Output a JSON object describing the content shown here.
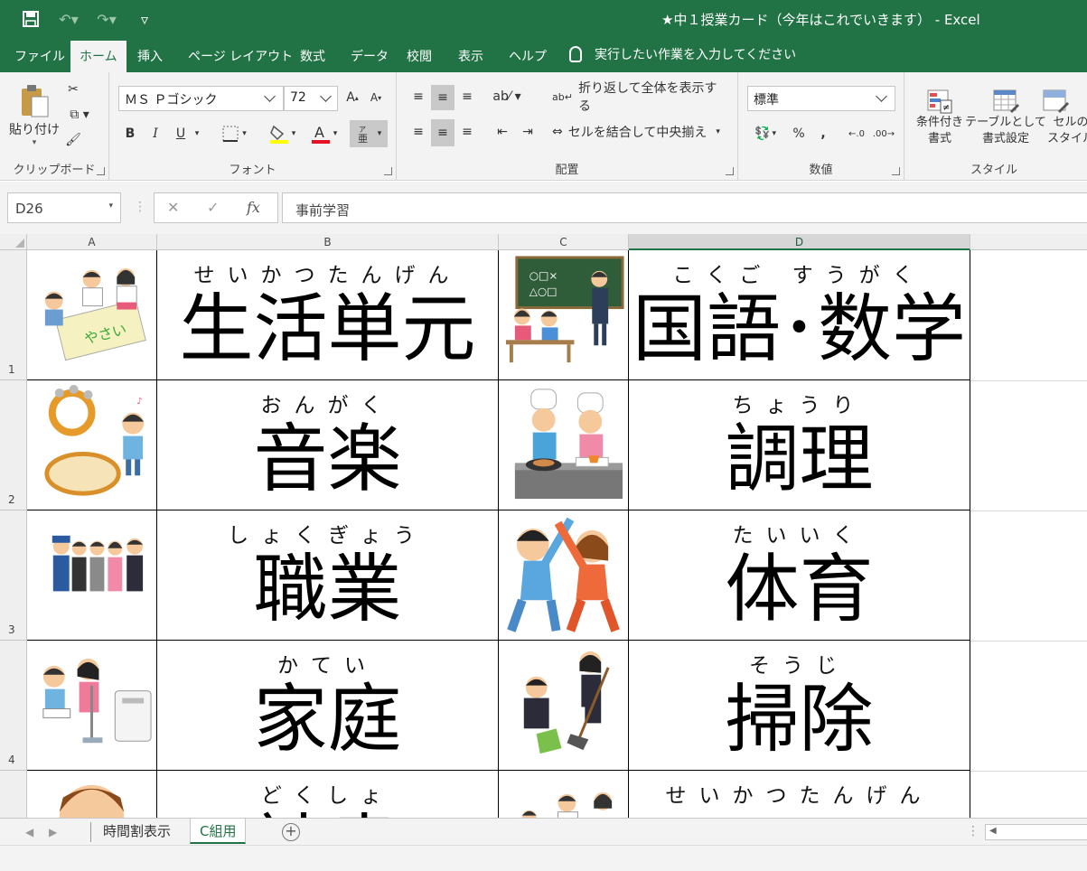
{
  "window": {
    "title": "★中１授業カード（今年はこれでいきます） - Excel"
  },
  "tabs": [
    {
      "label": "ファイル"
    },
    {
      "label": "ホーム"
    },
    {
      "label": "挿入"
    },
    {
      "label": "ページ レイアウト"
    },
    {
      "label": "数式"
    },
    {
      "label": "データ"
    },
    {
      "label": "校閲"
    },
    {
      "label": "表示"
    },
    {
      "label": "ヘルプ"
    }
  ],
  "tell_me": "実行したい作業を入力してください",
  "ribbon": {
    "clipboard": {
      "paste": "貼り付け",
      "label": "クリップボード"
    },
    "font": {
      "name": "ＭＳ Ｐゴシック",
      "size": "72",
      "label": "フォント",
      "bold": "B",
      "italic": "I",
      "underline": "U"
    },
    "alignment": {
      "wrap": "折り返して全体を表示する",
      "merge": "セルを結合して中央揃え",
      "label": "配置"
    },
    "number": {
      "format": "標準",
      "percent": "%",
      "comma": ",",
      "label": "数値"
    },
    "styles": {
      "conditional": "条件付き\n書式",
      "table": "テーブルとして\n書式設定",
      "cell": "セルの\nスタイル",
      "label": "スタイル"
    }
  },
  "formula_bar": {
    "name_box": "D26",
    "fx": "fx",
    "content": "事前学習"
  },
  "columns": [
    "A",
    "B",
    "C",
    "D"
  ],
  "rows": [
    {
      "num": "1",
      "b_ruby": "せいかつたんげん",
      "b_text": "生活単元",
      "d_ruby": "こくご すうがく",
      "d_text": "国語･数学"
    },
    {
      "num": "2",
      "b_ruby": "おんがく",
      "b_text": "音楽",
      "d_ruby": "ちょうり",
      "d_text": "調理"
    },
    {
      "num": "3",
      "b_ruby": "しょくぎょう",
      "b_text": "職業",
      "d_ruby": "たいいく",
      "d_text": "体育"
    },
    {
      "num": "4",
      "b_ruby": "かてい",
      "b_text": "家庭",
      "d_ruby": "そうじ",
      "d_text": "掃除"
    },
    {
      "num": "",
      "b_ruby": "どくしょ",
      "b_text": "読書",
      "d_ruby": "せいかつたんげん",
      "d_text": ""
    }
  ],
  "sheets": [
    {
      "label": "時間割表示"
    },
    {
      "label": "C組用"
    }
  ],
  "colors": {
    "excel_green": "#217346",
    "ribbon_bg": "#f3f3f3"
  }
}
